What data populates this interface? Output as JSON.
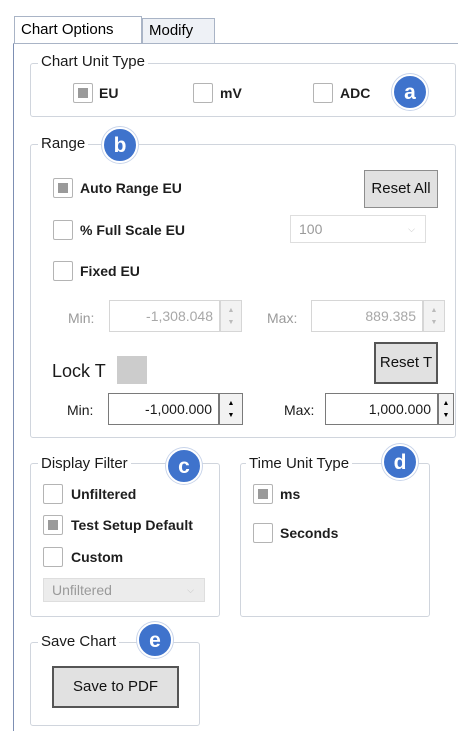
{
  "tabs": [
    {
      "label": "Chart Options"
    },
    {
      "label": "Modify"
    }
  ],
  "chart_unit_type": {
    "legend": "Chart Unit Type",
    "options": [
      {
        "label": "EU",
        "checked": true
      },
      {
        "label": "mV",
        "checked": false
      },
      {
        "label": "ADC",
        "checked": false
      }
    ],
    "badge": "a"
  },
  "range": {
    "legend": "Range",
    "badge": "b",
    "auto_range": {
      "label": "Auto Range EU",
      "checked": true
    },
    "full_scale": {
      "label": "% Full Scale EU",
      "checked": false
    },
    "full_scale_value": "100",
    "fixed": {
      "label": "Fixed EU",
      "checked": false
    },
    "reset_all_label": "Reset All",
    "min_label": "Min:",
    "max_label": "Max:",
    "eu_min": "-1,308.048",
    "eu_max": "889.385",
    "lock_t_label": "Lock T",
    "reset_t_label": "Reset T",
    "t_min": "-1,000.000",
    "t_max": "1,000.000"
  },
  "display_filter": {
    "legend": "Display Filter",
    "badge": "c",
    "options": [
      {
        "label": "Unfiltered",
        "checked": false
      },
      {
        "label": "Test Setup Default",
        "checked": true
      },
      {
        "label": "Custom",
        "checked": false
      }
    ],
    "select_value": "Unfiltered"
  },
  "time_unit_type": {
    "legend": "Time Unit Type",
    "badge": "d",
    "options": [
      {
        "label": "ms",
        "checked": true
      },
      {
        "label": "Seconds",
        "checked": false
      }
    ]
  },
  "save_chart": {
    "legend": "Save Chart",
    "badge": "e",
    "button_label": "Save to PDF"
  },
  "colors": {
    "badge": "#3f73cc",
    "panel_border": "#d0d5dd"
  }
}
